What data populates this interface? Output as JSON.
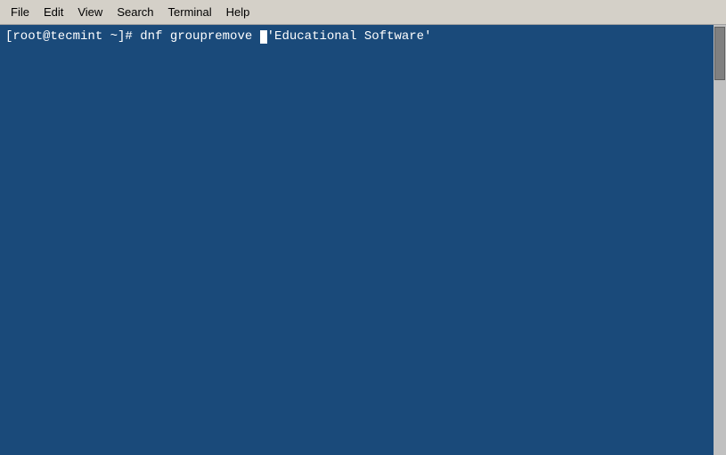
{
  "menubar": {
    "items": [
      {
        "id": "file",
        "label": "File"
      },
      {
        "id": "edit",
        "label": "Edit"
      },
      {
        "id": "view",
        "label": "View"
      },
      {
        "id": "search",
        "label": "Search"
      },
      {
        "id": "terminal",
        "label": "Terminal"
      },
      {
        "id": "help",
        "label": "Help"
      }
    ]
  },
  "terminal": {
    "background_color": "#1a4a7a",
    "line": "[root@tecmint ~]# dnf groupremove 'Educational Software'",
    "prompt": "[root@tecmint ~]# ",
    "command": "dnf groupremove ",
    "argument": "'Educational Software'"
  }
}
